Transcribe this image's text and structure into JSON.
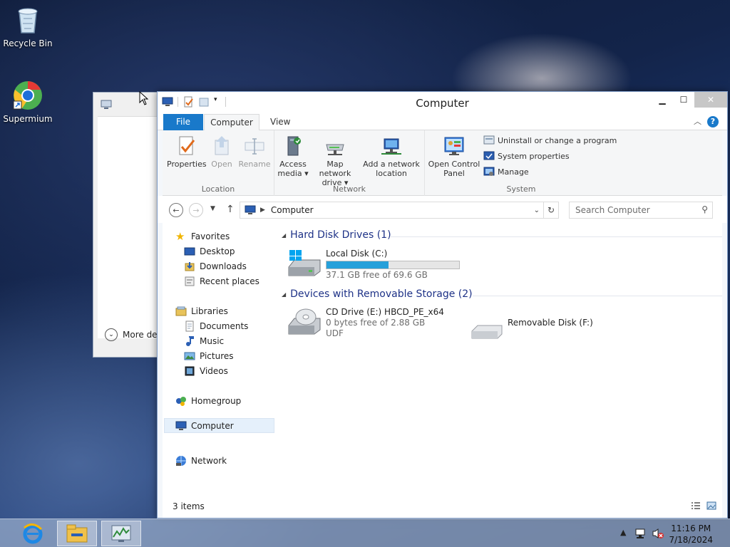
{
  "desktop": {
    "icons": [
      {
        "label": "Recycle Bin",
        "icon": "recycle-bin-icon"
      },
      {
        "label": "Supermium",
        "icon": "browser-icon"
      }
    ]
  },
  "back_dialog": {
    "more_label": "More det"
  },
  "window": {
    "title": "Computer",
    "tabs": {
      "file": "File",
      "computer": "Computer",
      "view": "View"
    },
    "ribbon": {
      "location": {
        "label": "Location",
        "properties": "Properties",
        "open": "Open",
        "rename": "Rename"
      },
      "network": {
        "label": "Network",
        "access_media_1": "Access",
        "access_media_2": "media ▾",
        "map_drive_1": "Map network",
        "map_drive_2": "drive ▾",
        "add_location_1": "Add a network",
        "add_location_2": "location"
      },
      "system": {
        "label": "System",
        "control_panel_1": "Open Control",
        "control_panel_2": "Panel",
        "uninstall": "Uninstall or change a program",
        "properties": "System properties",
        "manage": "Manage"
      }
    },
    "address": {
      "crumb": "Computer",
      "search_placeholder": "Search Computer"
    },
    "nav": {
      "favorites": "Favorites",
      "desktop": "Desktop",
      "downloads": "Downloads",
      "recent": "Recent places",
      "libraries": "Libraries",
      "documents": "Documents",
      "music": "Music",
      "pictures": "Pictures",
      "videos": "Videos",
      "homegroup": "Homegroup",
      "computer": "Computer",
      "network": "Network"
    },
    "content": {
      "hdd_header": "Hard Disk Drives (1)",
      "removable_header": "Devices with Removable Storage (2)",
      "local_disk": {
        "name": "Local Disk (C:)",
        "free": "37.1 GB free of 69.6 GB",
        "used_fraction": 0.467
      },
      "cd_drive": {
        "name": "CD Drive (E:) HBCD_PE_x64",
        "free": "0 bytes free of 2.88 GB",
        "fs": "UDF"
      },
      "removable": {
        "name": "Removable Disk (F:)"
      }
    },
    "status": {
      "count": "3 items"
    }
  },
  "taskbar": {
    "time": "11:16 PM",
    "date": "7/18/2024"
  },
  "colors": {
    "accent": "#1979ca",
    "progress": "#26a0da",
    "header_text": "#1e3287"
  }
}
